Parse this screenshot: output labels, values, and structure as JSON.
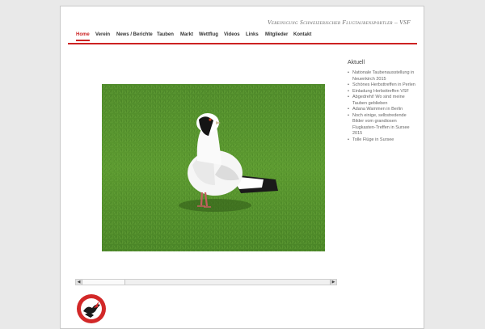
{
  "site": {
    "title": "Vereinigung Schweizerischer Flugtaubensportler – VSF"
  },
  "nav": {
    "items": [
      {
        "label": "Home",
        "active": true
      },
      {
        "label": "Verein",
        "active": false
      },
      {
        "label": "News / Berichte",
        "active": false
      },
      {
        "label": "Tauben",
        "active": false
      },
      {
        "label": "Markt",
        "active": false
      },
      {
        "label": "Wettflug",
        "active": false
      },
      {
        "label": "Videos",
        "active": false
      },
      {
        "label": "Links",
        "active": false
      },
      {
        "label": "Mitglieder",
        "active": false
      },
      {
        "label": "Kontakt",
        "active": false
      }
    ]
  },
  "slider": {
    "photo_subject": "white pigeon with black head on grass",
    "scroll_left_icon": "arrow-left-icon",
    "scroll_right_icon": "arrow-right-icon"
  },
  "sidebar": {
    "title": "Aktuell",
    "items": [
      "Nationale Taubenausstellung in Neuenkirch 2015",
      "Schönes Herbsttreffen in Perlen",
      "Einladung Herbsttreffen VSF",
      "Abgedreht! Wo sind meine Tauben geblieben",
      "Adana Wammen in Berlin",
      "Noch einige, selbstredende Bilder vom grandiosen Flugkasten-Treffen in Sursee 2015",
      "Tolle Flüge in Sursee"
    ]
  },
  "colors": {
    "accent": "#cc2222",
    "nav_text": "#333333",
    "sidebar_text": "#666666",
    "background": "#e9e9e9"
  },
  "footer": {
    "logo_icon": "vsf-logo-icon"
  }
}
